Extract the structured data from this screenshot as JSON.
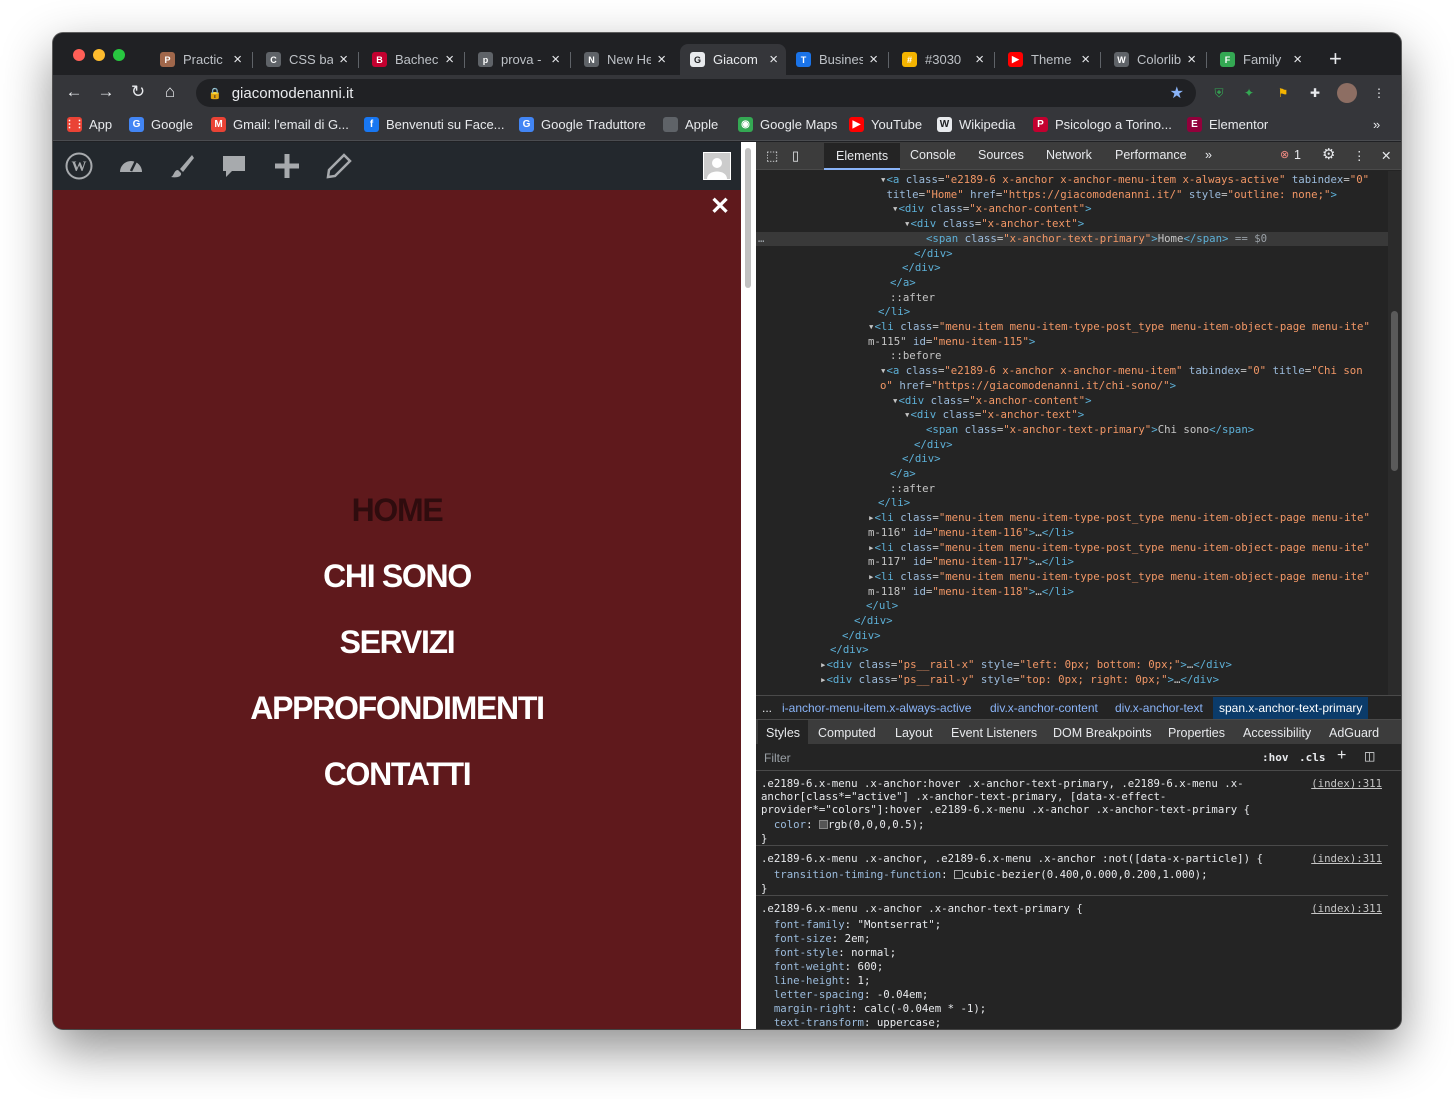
{
  "browser": {
    "tabs": [
      {
        "title": "Practic",
        "fav_color": "#a0674b",
        "fav": "P"
      },
      {
        "title": "CSS ba",
        "fav_color": "#5f6368",
        "fav": "C"
      },
      {
        "title": "Bachec",
        "fav_color": "#c3002f",
        "fav": "B"
      },
      {
        "title": "prova -",
        "fav_color": "#5f6368",
        "fav": "p"
      },
      {
        "title": "New He",
        "fav_color": "#5f6368",
        "fav": "N"
      },
      {
        "title": "Giacom",
        "fav_color": "#e8eaed",
        "fav": "G"
      },
      {
        "title": "Busines",
        "fav_color": "#1a73e8",
        "fav": "T"
      },
      {
        "title": "#3030",
        "fav_color": "#f4b400",
        "fav": "#"
      },
      {
        "title": "Theme",
        "fav_color": "#ff0000",
        "fav": "▶"
      },
      {
        "title": "Colorlib",
        "fav_color": "#5f6368",
        "fav": "W"
      },
      {
        "title": "Family",
        "fav_color": "#34a853",
        "fav": "F"
      }
    ],
    "url": "giacomodenanni.it",
    "bookmarks": [
      {
        "label": "App",
        "color": "#ea4335",
        "icon": "⋮⋮"
      },
      {
        "label": "Google",
        "color": "#4285f4",
        "icon": "G"
      },
      {
        "label": "Gmail: l'email di G...",
        "color": "#ea4335",
        "icon": "M"
      },
      {
        "label": "Benvenuti su Face...",
        "color": "#1877f2",
        "icon": "f"
      },
      {
        "label": "Google Traduttore",
        "color": "#4285f4",
        "icon": "G"
      },
      {
        "label": "Apple",
        "color": "#5f6368",
        "icon": ""
      },
      {
        "label": "Google Maps",
        "color": "#34a853",
        "icon": "◉"
      },
      {
        "label": "YouTube",
        "color": "#ff0000",
        "icon": "▶"
      },
      {
        "label": "Wikipedia",
        "color": "#e8eaed",
        "icon": "W"
      },
      {
        "label": "Psicologo a Torino...",
        "color": "#c3002f",
        "icon": "P"
      },
      {
        "label": "Elementor",
        "color": "#92003b",
        "icon": "E"
      }
    ],
    "bookmarks_more": "»"
  },
  "page": {
    "close_symbol": "✕",
    "menu": [
      "HOME",
      "CHI SONO",
      "SERVIZI",
      "APPROFONDIMENTI",
      "CONTATTI"
    ]
  },
  "devtools": {
    "tabs": [
      "Elements",
      "Console",
      "Sources",
      "Network",
      "Performance"
    ],
    "more": "»",
    "error_count": "1",
    "breadcrumbs": [
      "...",
      "i-anchor-menu-item.x-always-active",
      "div.x-anchor-content",
      "div.x-anchor-text",
      "span.x-anchor-text-primary"
    ],
    "subtabs": [
      "Styles",
      "Computed",
      "Layout",
      "Event Listeners",
      "DOM Breakpoints",
      "Properties",
      "Accessibility",
      "AdGuard"
    ],
    "filter_placeholder": "Filter",
    "filter_hov": ":hov",
    "filter_cls": ".cls"
  },
  "colors": {
    "page_bg": "#5f191c",
    "devtools_bg": "#242424",
    "accent": "#8ab4f8"
  }
}
